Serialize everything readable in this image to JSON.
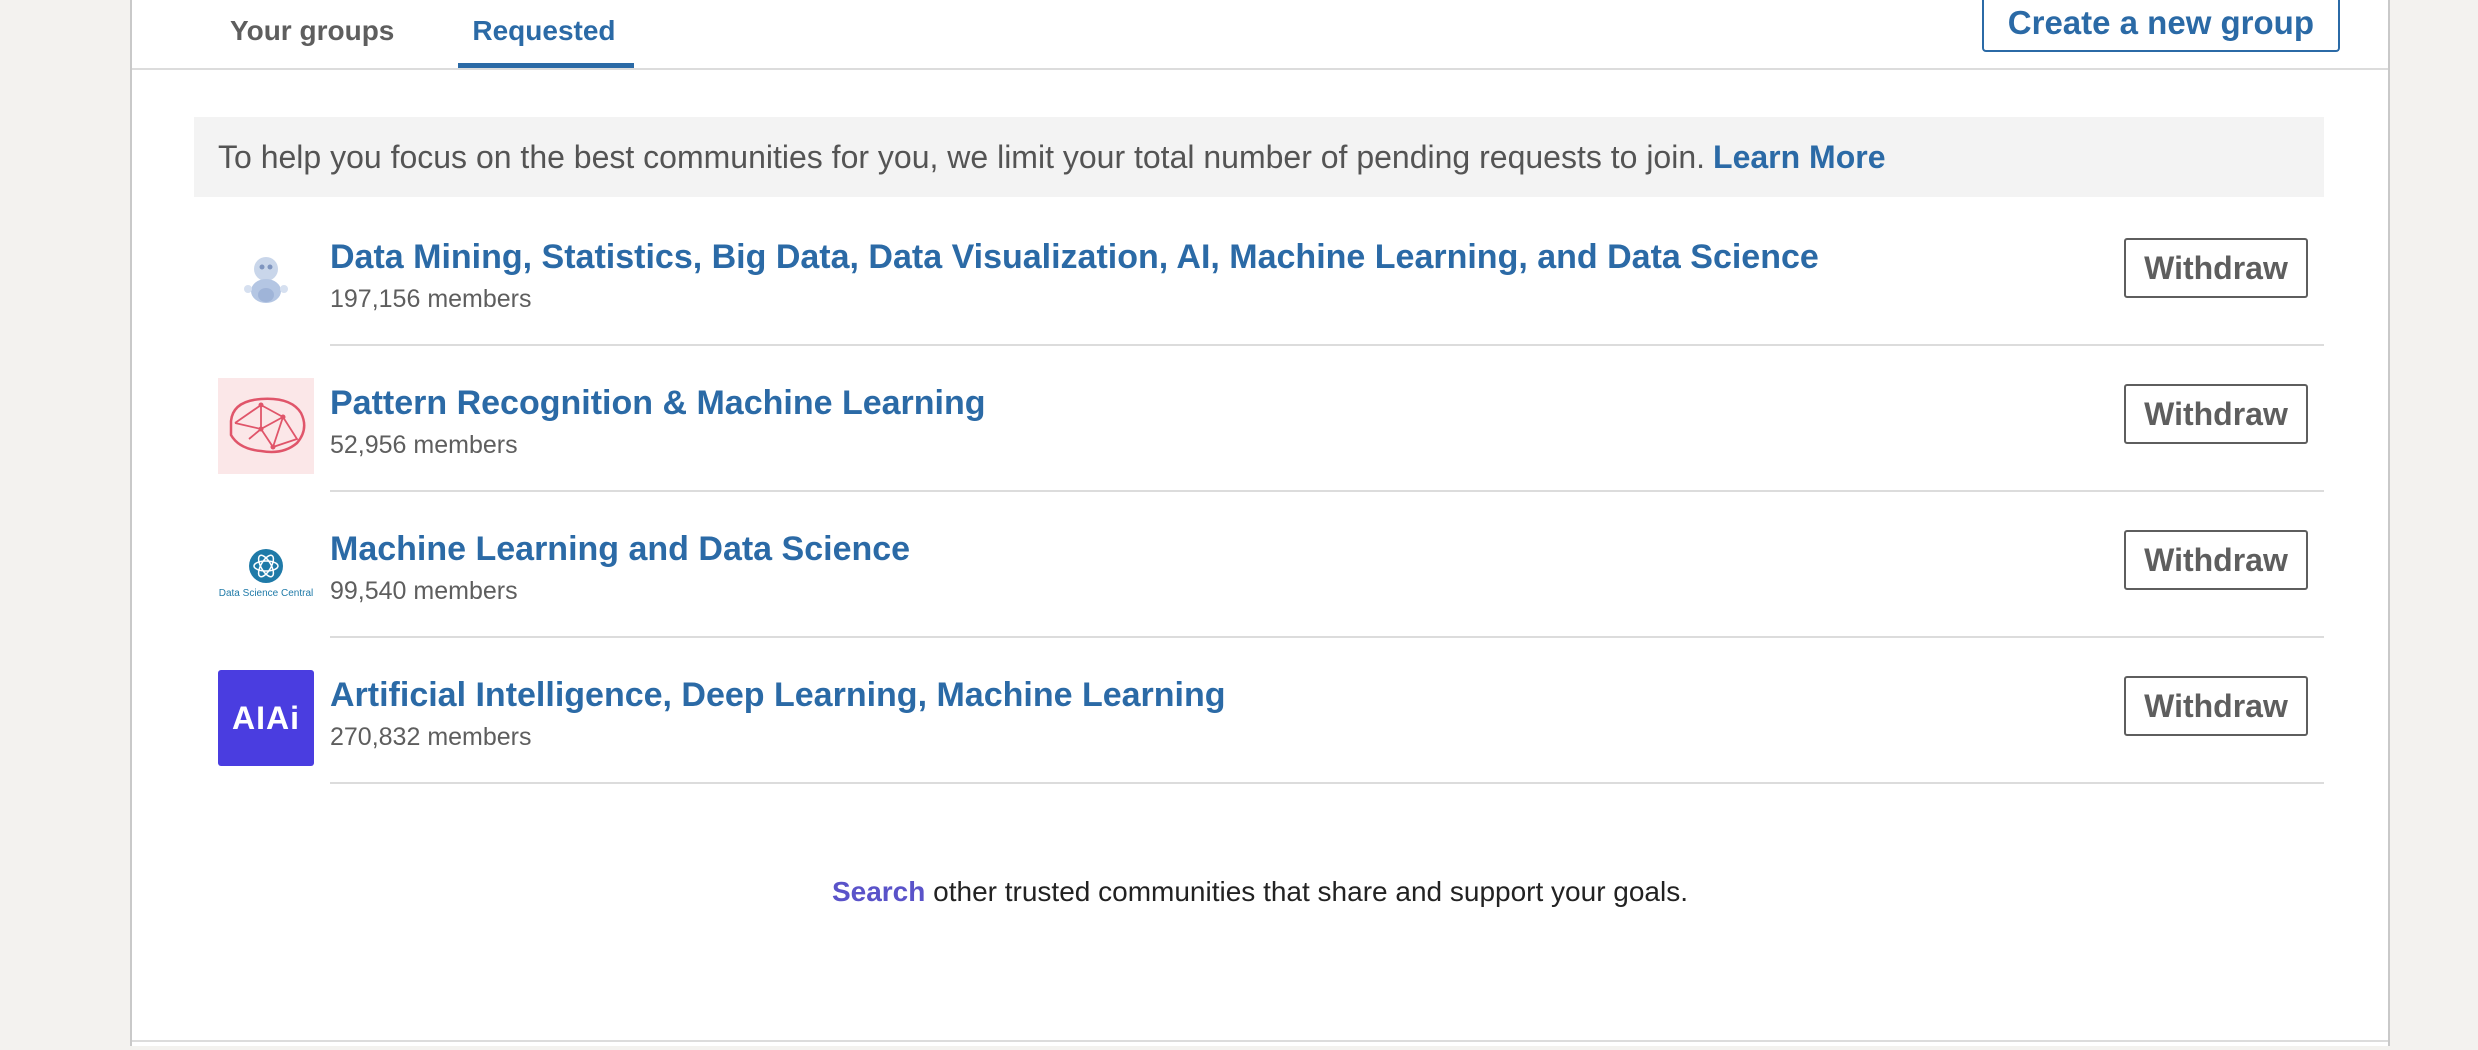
{
  "tabs": [
    {
      "label": "Your groups",
      "active": false
    },
    {
      "label": "Requested",
      "active": true
    }
  ],
  "create_group_label": "Create a new group",
  "notice": {
    "text": "To help you focus on the best communities for you, we limit your total number of pending requests to join.",
    "link": "Learn More"
  },
  "groups": [
    {
      "name": "Data Mining, Statistics, Big Data, Data Visualization, AI, Machine Learning, and Data Science",
      "members": "197,156 members",
      "action": "Withdraw"
    },
    {
      "name": "Pattern Recognition & Machine Learning",
      "members": "52,956 members",
      "action": "Withdraw"
    },
    {
      "name": "Machine Learning and Data Science",
      "members": "99,540 members",
      "action": "Withdraw",
      "logo_caption": "Data Science Central"
    },
    {
      "name": "Artificial Intelligence, Deep Learning, Machine Learning",
      "members": "270,832 members",
      "action": "Withdraw",
      "logo_text": "AIAi"
    }
  ],
  "footer": {
    "link": "Search",
    "text": "other trusted communities that share and support your goals."
  },
  "colors": {
    "accent": "#2b6aa6",
    "search_link": "#5a53c9",
    "ai_logo_bg": "#4a3de0"
  }
}
